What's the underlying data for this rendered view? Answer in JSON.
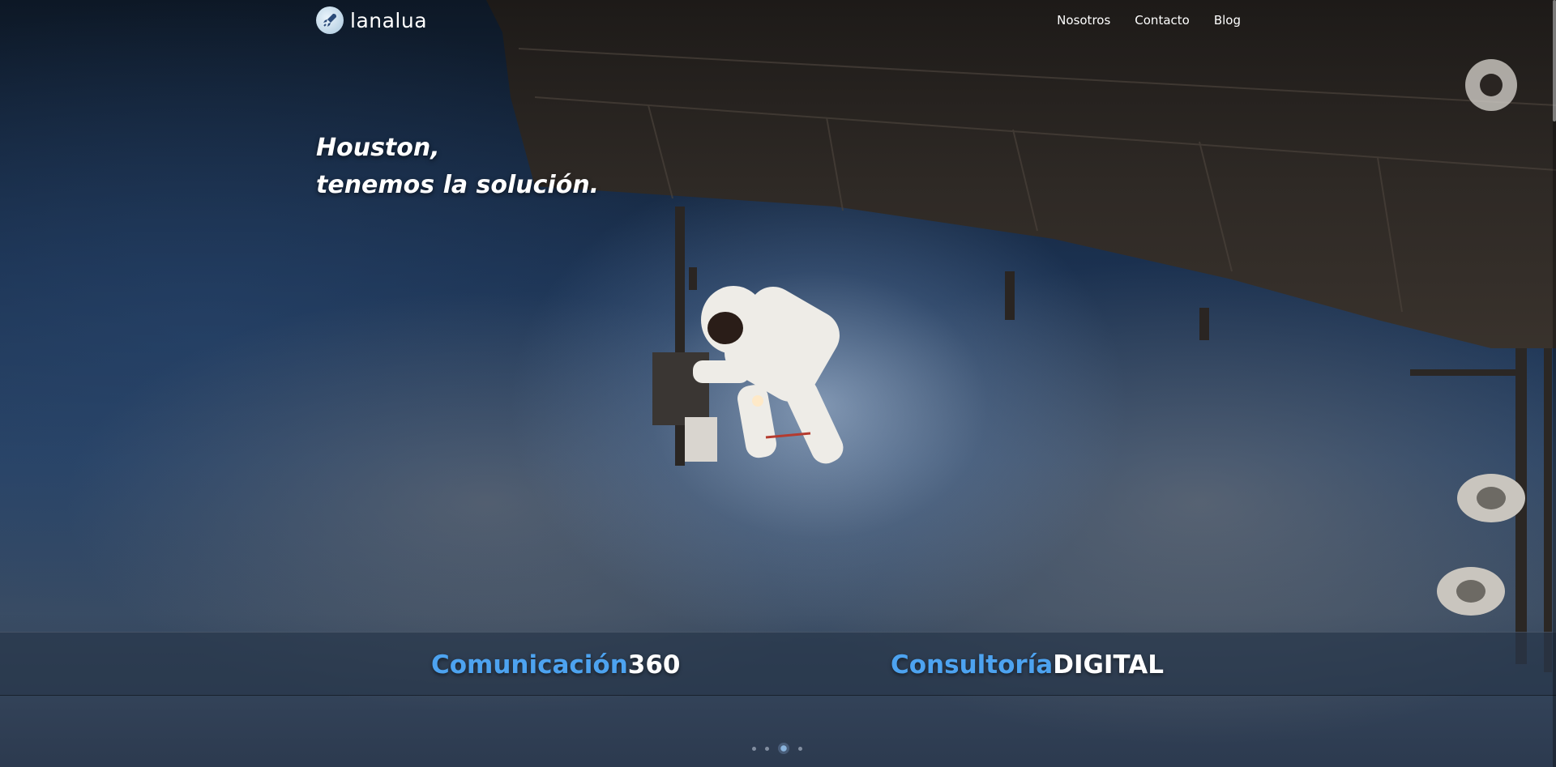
{
  "brand": {
    "name": "lanalua",
    "logo_icon": "rocket-icon"
  },
  "nav": {
    "items": [
      {
        "label": "Nosotros"
      },
      {
        "label": "Contacto"
      },
      {
        "label": "Blog"
      }
    ]
  },
  "hero": {
    "line1": "Houston,",
    "line2": "tenemos la solución."
  },
  "services": [
    {
      "accent": "Comunicación",
      "strong": "360"
    },
    {
      "accent": "Consultoría",
      "strong": "DIGITAL"
    }
  ],
  "carousel": {
    "total_slides": 4,
    "active_slide": 3
  },
  "colors": {
    "accent": "#4da3f0",
    "text": "#ffffff"
  }
}
